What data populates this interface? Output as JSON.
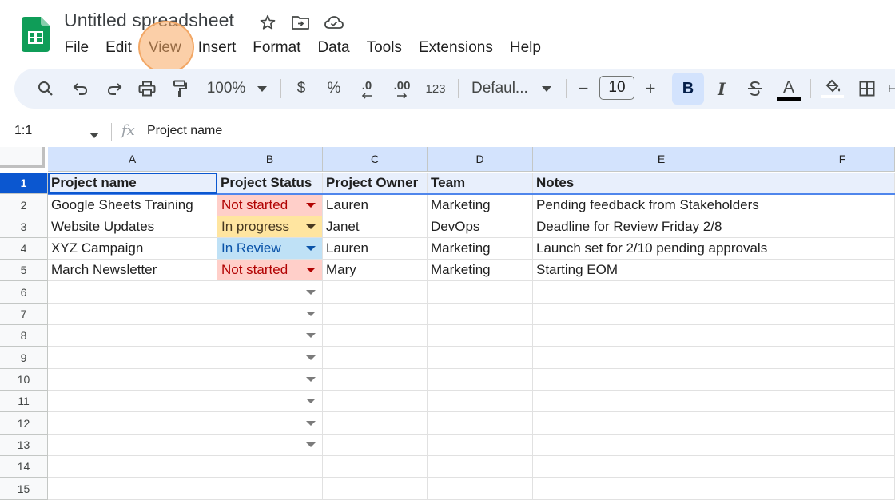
{
  "app": {
    "title": "Untitled spreadsheet",
    "logo_icon": "sheets-logo-icon",
    "brand_color": "#0f9d58"
  },
  "menu": [
    "File",
    "Edit",
    "View",
    "Insert",
    "Format",
    "Data",
    "Tools",
    "Extensions",
    "Help"
  ],
  "toolbar": {
    "zoom": "100%",
    "currency": "$",
    "percent": "%",
    "decrease_decimal": ".0",
    "increase_decimal": ".00",
    "number_format": "123",
    "font": "Defaul...",
    "font_size": "10",
    "minus": "−",
    "plus": "+",
    "bold": "B",
    "italic": "I",
    "text_color": "A"
  },
  "formula_bar": {
    "name_box": "1:1",
    "fx": "fx",
    "content": "Project name"
  },
  "columns": [
    "A",
    "B",
    "C",
    "D",
    "E",
    "F"
  ],
  "row_numbers": [
    "1",
    "2",
    "3",
    "4",
    "5",
    "6",
    "7",
    "8",
    "9",
    "10",
    "11",
    "12",
    "13",
    "14",
    "15"
  ],
  "headers": [
    "Project name",
    "Project Status",
    "Project Owner",
    "Team",
    "Notes"
  ],
  "rows": [
    {
      "name": "Google Sheets Training",
      "status": "Not started",
      "status_key": "ns",
      "owner": "Lauren",
      "team": "Marketing",
      "notes": "Pending feedback from Stakeholders"
    },
    {
      "name": "Website Updates",
      "status": "In progress",
      "status_key": "ip",
      "owner": "Janet",
      "team": "DevOps",
      "notes": "Deadline for Review Friday 2/8"
    },
    {
      "name": "XYZ Campaign",
      "status": "In Review",
      "status_key": "ir",
      "owner": "Lauren",
      "team": "Marketing",
      "notes": "Launch set for 2/10 pending approvals"
    },
    {
      "name": "March Newsletter",
      "status": "Not started",
      "status_key": "ns",
      "owner": "Mary",
      "team": "Marketing",
      "notes": "Starting EOM"
    }
  ],
  "status_colors": {
    "not_started": {
      "bg": "#ffcfc9",
      "fg": "#b10202"
    },
    "in_progress": {
      "bg": "#ffe5a0",
      "fg": "#473821"
    },
    "in_review": {
      "bg": "#bfe1f6",
      "fg": "#0a53a8"
    }
  },
  "empty_dropdown_rows": 8,
  "highlight": {
    "target": "View",
    "color": "#f8a860"
  }
}
